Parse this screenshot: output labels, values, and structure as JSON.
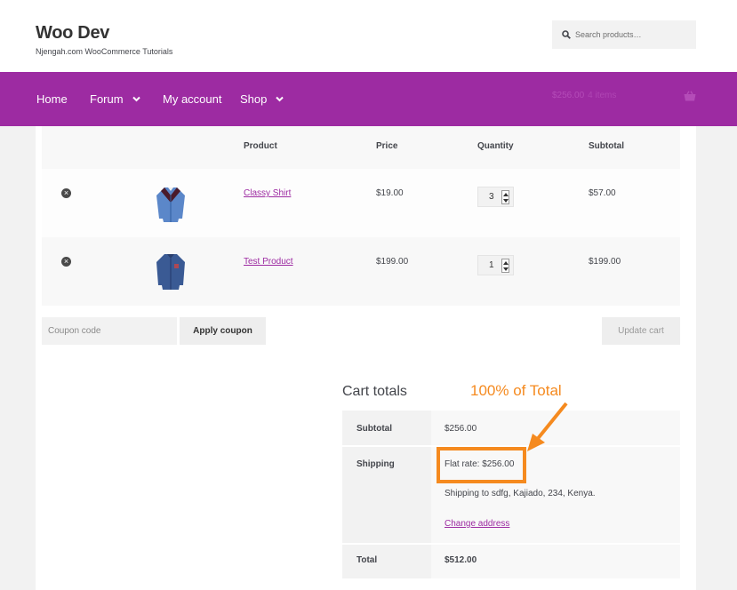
{
  "header": {
    "site_title": "Woo Dev",
    "site_description": "Njengah.com WooCommerce Tutorials",
    "search_placeholder": "Search products…",
    "search_icon": "search-icon"
  },
  "nav": {
    "items": [
      {
        "label": "Home",
        "has_dropdown": false
      },
      {
        "label": "Forum",
        "has_dropdown": true
      },
      {
        "label": "My account",
        "has_dropdown": false
      },
      {
        "label": "Shop",
        "has_dropdown": true
      }
    ],
    "cart_amount": "$256.00",
    "cart_count": "4 items",
    "basket_icon": "basket-icon"
  },
  "cart_table": {
    "headers": [
      "Product",
      "Price",
      "Quantity",
      "Subtotal"
    ],
    "rows": [
      {
        "name": "Classy Shirt",
        "price": "$19.00",
        "quantity": "3",
        "subtotal": "$57.00"
      },
      {
        "name": "Test Product",
        "price": "$199.00",
        "quantity": "1",
        "subtotal": "$199.00"
      }
    ]
  },
  "coupon": {
    "placeholder": "Coupon code",
    "apply_label": "Apply coupon",
    "update_label": "Update cart"
  },
  "totals": {
    "title": "Cart totals",
    "subtotal_label": "Subtotal",
    "subtotal_value": "$256.00",
    "shipping_label": "Shipping",
    "shipping_method": "Flat rate: $256.00",
    "shipping_to": "Shipping to sdfg, Kajiado, 234, Kenya.",
    "change_address": "Change address",
    "total_label": "Total",
    "total_value": "$512.00"
  },
  "annotation": {
    "text": "100% of Total",
    "color": "#f58a1f"
  },
  "colors": {
    "brand": "#9d2ba2",
    "highlight": "#f58a1f"
  }
}
